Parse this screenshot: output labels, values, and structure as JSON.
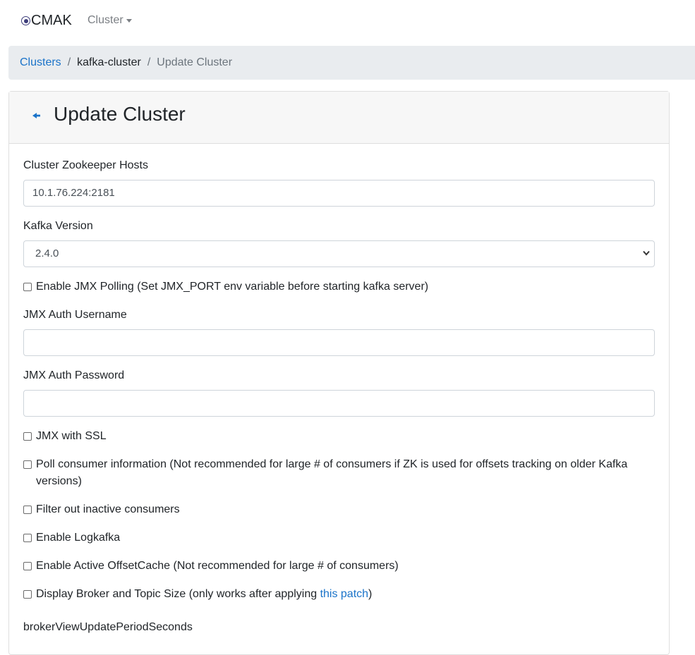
{
  "navbar": {
    "brand": "CMAK",
    "cluster_menu": "Cluster"
  },
  "breadcrumb": {
    "clusters": "Clusters",
    "separator": "/",
    "cluster_name": "kafka-cluster",
    "current": "Update Cluster"
  },
  "page": {
    "title": "Update Cluster"
  },
  "form": {
    "zk_hosts_label": "Cluster Zookeeper Hosts",
    "zk_hosts_value": "10.1.76.224:2181",
    "kafka_version_label": "Kafka Version",
    "kafka_version_value": "2.4.0",
    "jmx_polling_label": "Enable JMX Polling (Set JMX_PORT env variable before starting kafka server)",
    "jmx_user_label": "JMX Auth Username",
    "jmx_user_value": "",
    "jmx_pass_label": "JMX Auth Password",
    "jmx_pass_value": "",
    "jmx_ssl_label": "JMX with SSL",
    "poll_consumer_label": "Poll consumer information (Not recommended for large # of consumers if ZK is used for offsets tracking on older Kafka versions)",
    "filter_inactive_label": "Filter out inactive consumers",
    "logkafka_label": "Enable Logkafka",
    "offset_cache_label": "Enable Active OffsetCache (Not recommended for large # of consumers)",
    "display_size_label": "Display Broker and Topic Size (only works after applying ",
    "display_size_link": "this patch",
    "display_size_suffix": ")",
    "broker_view_label": "brokerViewUpdatePeriodSeconds"
  },
  "colors": {
    "link": "#1a73c9",
    "breadcrumb_bg": "#e9ecef",
    "header_bg": "#f7f7f7"
  },
  "icons": {
    "brand": "cmak-logo-icon",
    "back": "back-arrow-icon",
    "dropdown": "caret-down-icon",
    "select": "chevron-down-icon"
  }
}
